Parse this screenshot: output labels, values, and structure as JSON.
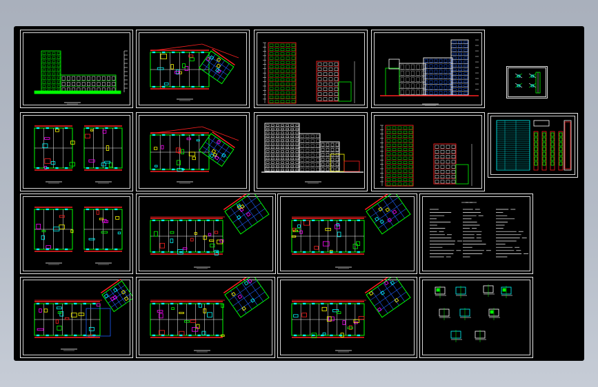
{
  "viewport": {
    "background": "#b4bbc6",
    "drawing_area_color": "#000000"
  },
  "palette": {
    "green": "#00ff00",
    "red": "#ff2020",
    "yellow": "#ffff00",
    "blue": "#2060ff",
    "cyan": "#00ffff",
    "magenta": "#ff00ff",
    "white": "#ffffff",
    "gray": "#9a9a9a"
  },
  "sheets": [
    {
      "id": "s1",
      "kind": "side-elevation"
    },
    {
      "id": "s2",
      "kind": "floor-plan-angled"
    },
    {
      "id": "s3",
      "kind": "section-elevations"
    },
    {
      "id": "s4",
      "kind": "front-elevation"
    },
    {
      "id": "s5",
      "kind": "detail-small"
    },
    {
      "id": "s6",
      "kind": "unit-plans"
    },
    {
      "id": "s7",
      "kind": "floor-plan-angled"
    },
    {
      "id": "s8",
      "kind": "elevation-white"
    },
    {
      "id": "s9",
      "kind": "section-elevations"
    },
    {
      "id": "s10",
      "kind": "door-window-schedule"
    },
    {
      "id": "s11",
      "kind": "unit-plans"
    },
    {
      "id": "s12",
      "kind": "floor-plan-wing"
    },
    {
      "id": "s13",
      "kind": "floor-plan-wing"
    },
    {
      "id": "s14",
      "kind": "design-notes"
    },
    {
      "id": "s15",
      "kind": "floor-plan-wing"
    },
    {
      "id": "s16",
      "kind": "floor-plan-wing"
    },
    {
      "id": "s17",
      "kind": "floor-plan-wing"
    },
    {
      "id": "s18",
      "kind": "construction-details"
    }
  ]
}
